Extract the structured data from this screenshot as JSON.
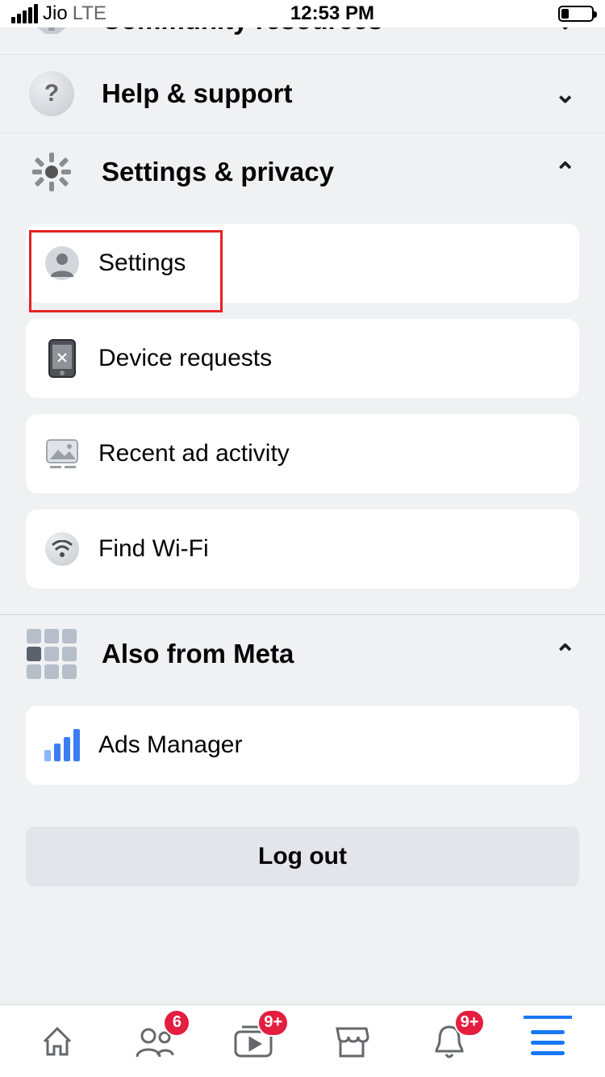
{
  "status": {
    "carrier": "Jio",
    "network": "LTE",
    "time": "12:53 PM"
  },
  "sections": {
    "community": {
      "title": "Community resources"
    },
    "help": {
      "title": "Help & support"
    },
    "settings_privacy": {
      "title": "Settings & privacy",
      "items": [
        {
          "label": "Settings"
        },
        {
          "label": "Device requests"
        },
        {
          "label": "Recent ad activity"
        },
        {
          "label": "Find Wi-Fi"
        }
      ]
    },
    "also_from_meta": {
      "title": "Also from Meta",
      "items": [
        {
          "label": "Ads Manager"
        }
      ]
    }
  },
  "logout": {
    "label": "Log out"
  },
  "nav": {
    "friends_badge": "6",
    "watch_badge": "9+",
    "notifications_badge": "9+"
  }
}
